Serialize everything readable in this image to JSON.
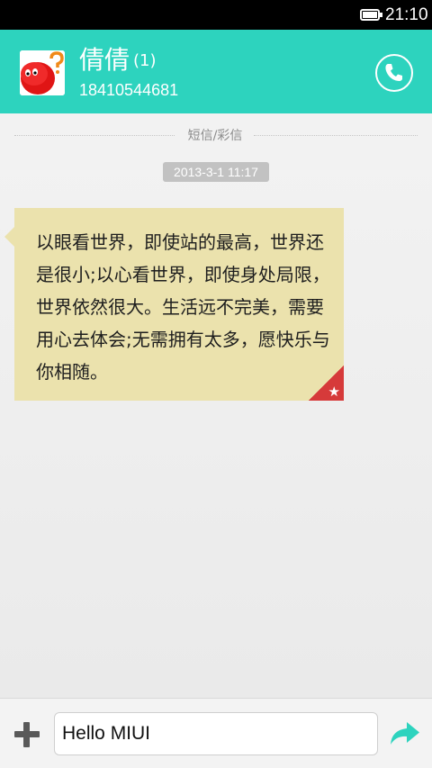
{
  "status_bar": {
    "time": "21:10",
    "battery_icon": "battery-full-icon"
  },
  "header": {
    "contact_name": "倩倩",
    "unread_count": "(1)",
    "phone_number": "18410544681",
    "avatar_icon": "red-blob-question-avatar-icon",
    "call_icon": "phone-icon",
    "background_color": "#2dd3be"
  },
  "thread": {
    "section_label": "短信/彩信",
    "timestamp": "2013-3-1 11:17",
    "message": {
      "text": "以眼看世界，即使站的最高，世界还是很小;以心看世界，即使身处局限，世界依然很大。生活远不完美，需要用心去体会;无需拥有太多，愿快乐与你相随。",
      "bubble_color": "#ebe2ad",
      "star_color": "#d63a3a",
      "star_icon": "star-icon",
      "starred": true
    }
  },
  "composer": {
    "input_value": "Hello MIUI",
    "attach_icon": "plus-icon",
    "send_icon": "send-arrow-icon",
    "send_color": "#2dd3be"
  }
}
